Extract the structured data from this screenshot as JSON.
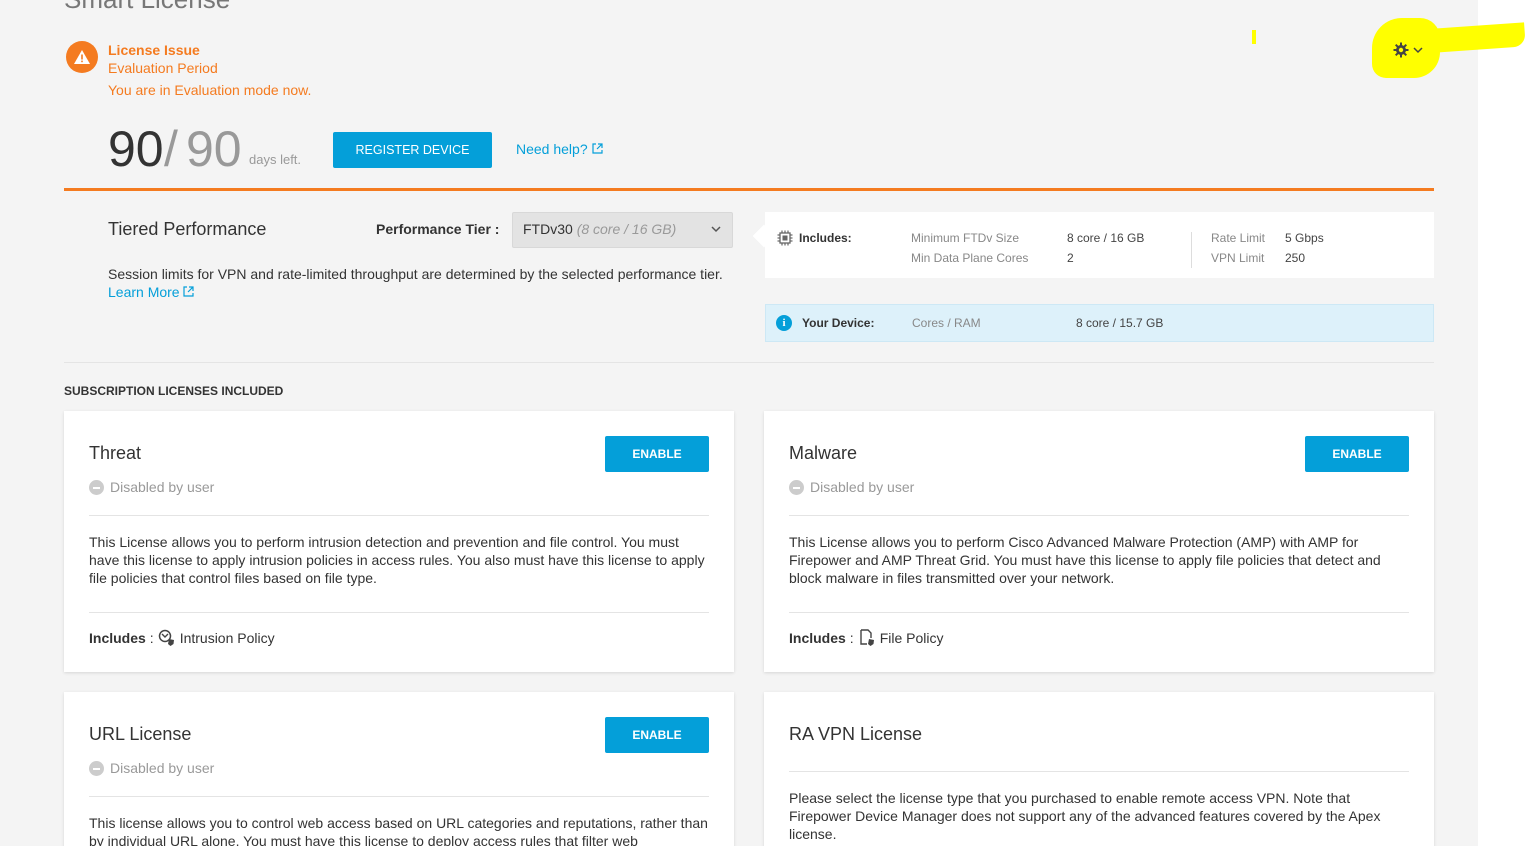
{
  "page": {
    "title": "Smart License"
  },
  "license_issue": {
    "title": "License Issue",
    "subtitle": "Evaluation Period",
    "message": "You are in Evaluation mode now."
  },
  "evaluation": {
    "days_used": "90",
    "slash": "/",
    "days_total": "90",
    "days_left_label": "days left.",
    "register_label": "REGISTER DEVICE",
    "help_label": "Need help?"
  },
  "tier": {
    "title": "Tiered Performance",
    "perf_label": "Performance Tier :",
    "selected_name": "FTDv30",
    "selected_detail": "(8 core / 16 GB)",
    "description": "Session limits for VPN and rate-limited throughput are determined by the selected performance tier.",
    "learn_more": "Learn More"
  },
  "includes": {
    "label": "Includes:",
    "min_size_key": "Minimum FTDv Size",
    "min_size_val": "8 core / 16 GB",
    "min_cores_key": "Min Data Plane Cores",
    "min_cores_val": "2",
    "rate_key": "Rate Limit",
    "rate_val": "5 Gbps",
    "vpn_key": "VPN Limit",
    "vpn_val": "250"
  },
  "device": {
    "label": "Your Device:",
    "key": "Cores / RAM",
    "value": "8 core / 15.7 GB"
  },
  "section_title": "SUBSCRIPTION LICENSES INCLUDED",
  "cards": {
    "threat": {
      "title": "Threat",
      "status": "Disabled by user",
      "button": "ENABLE",
      "description": "This License allows you to perform intrusion detection and prevention and file control. You must have this license to apply intrusion policies in access rules. You also must have this license to apply file policies that control files based on file type.",
      "includes_label": "Includes",
      "includes_item": "Intrusion Policy"
    },
    "malware": {
      "title": "Malware",
      "status": "Disabled by user",
      "button": "ENABLE",
      "description": "This License allows you to perform Cisco Advanced Malware Protection (AMP) with AMP for Firepower and AMP Threat Grid. You must have this license to apply file policies that detect and block malware in files transmitted over your network.",
      "includes_label": "Includes",
      "includes_item": "File Policy"
    },
    "url": {
      "title": "URL License",
      "status": "Disabled by user",
      "button": "ENABLE",
      "description": "This license allows you to control web access based on URL categories and reputations, rather than by individual URL alone. You must have this license to deploy access rules that filter web"
    },
    "ravpn": {
      "title": "RA VPN License",
      "description": "Please select the license type that you purchased to enable remote access VPN. Note that Firepower Device Manager does not support any of the advanced features covered by the Apex license."
    }
  },
  "colors": {
    "accent": "#049fd9",
    "warning": "#f47b20",
    "highlight": "#ffff00"
  },
  "icons": [
    "warning-icon",
    "external-link-icon",
    "gear-icon",
    "chevron-down-icon",
    "chip-icon",
    "info-icon",
    "minus-circle-icon",
    "intrusion-policy-icon",
    "file-policy-icon"
  ]
}
